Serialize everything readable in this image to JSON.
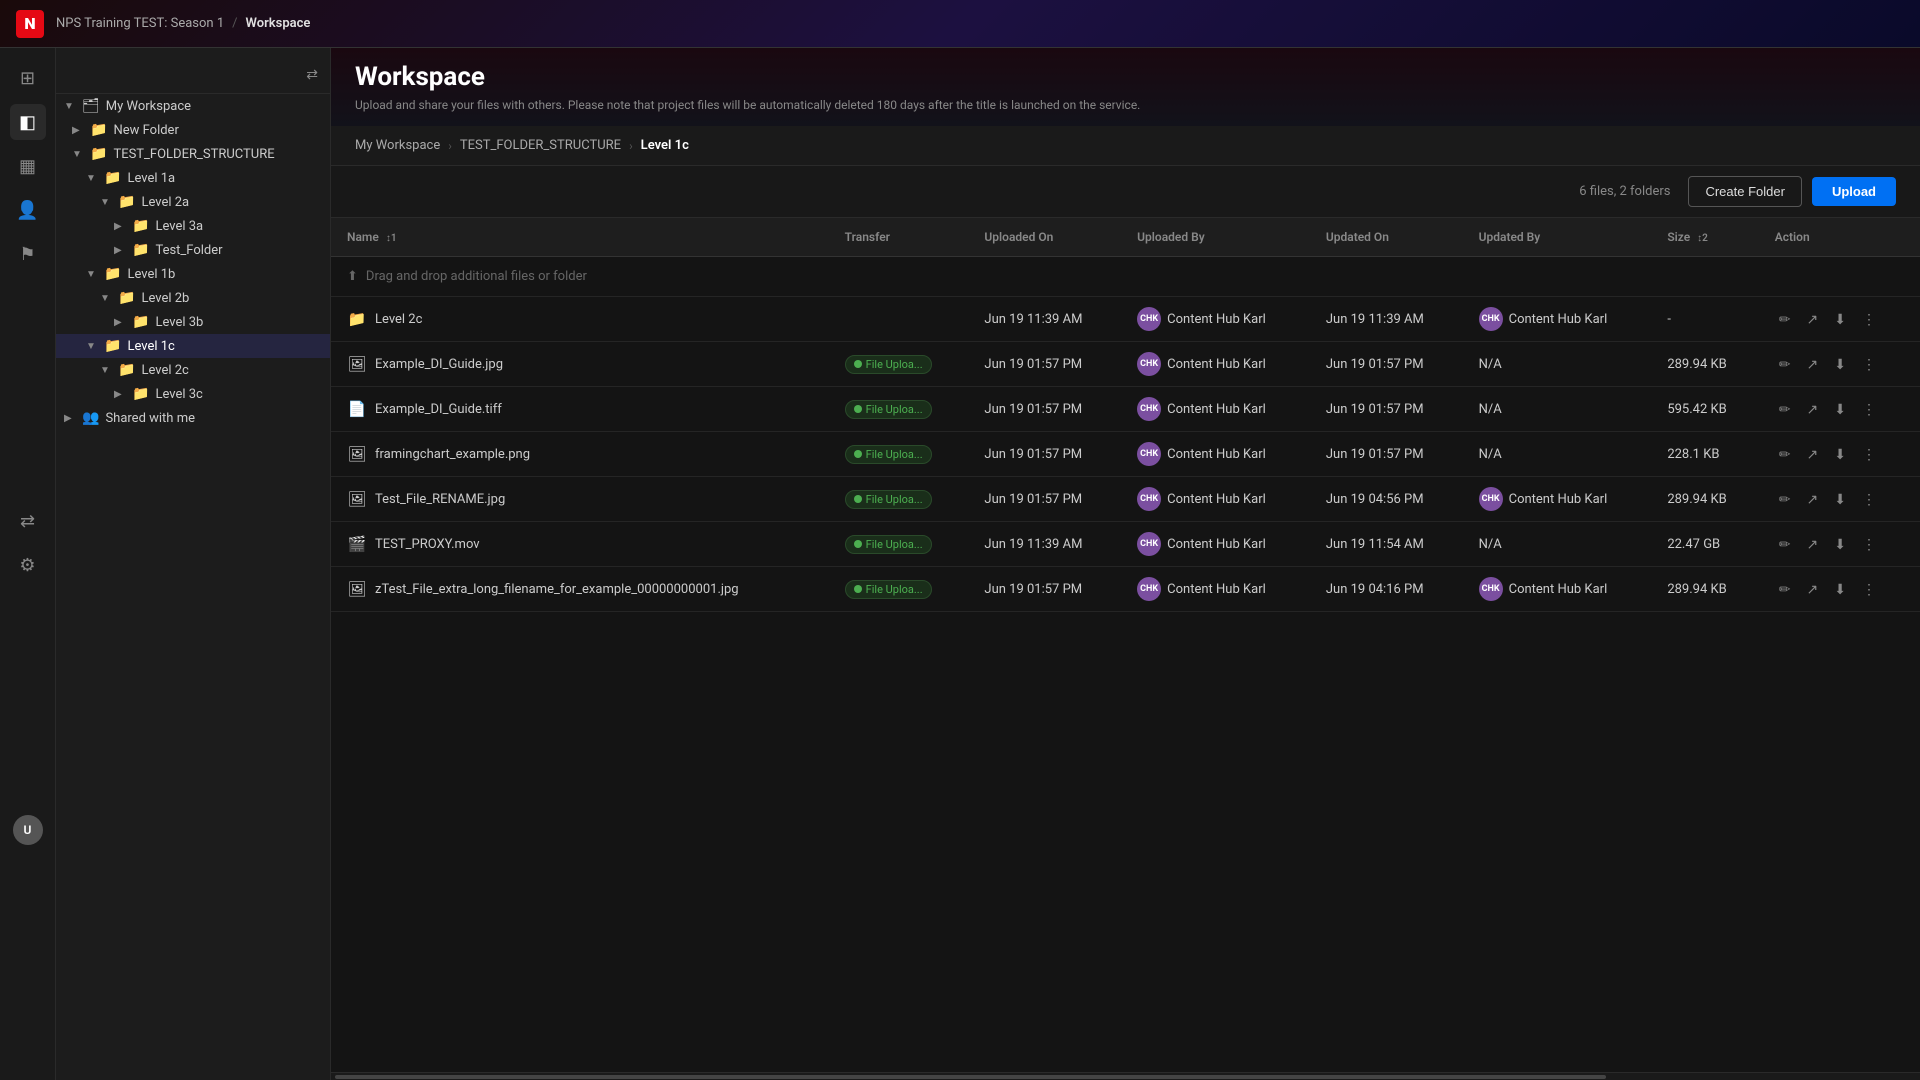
{
  "topbar": {
    "logo": "N",
    "breadcrumb": [
      {
        "label": "NPS Training TEST: Season 1",
        "id": "bc-season"
      },
      {
        "label": "Workspace",
        "id": "bc-workspace",
        "current": true
      }
    ]
  },
  "page": {
    "title": "Workspace",
    "subtitle": "Upload and share your files with others. Please note that project files will be automatically deleted 180 days after the title is launched on the service."
  },
  "breadcrumb_nav": [
    {
      "label": "My Workspace",
      "id": "bc-my-workspace"
    },
    {
      "label": "TEST_FOLDER_STRUCTURE",
      "id": "bc-test-folder"
    },
    {
      "label": "Level 1c",
      "id": "bc-level1c",
      "current": true
    }
  ],
  "toolbar": {
    "file_count": "6 files, 2 folders",
    "create_folder_label": "Create Folder",
    "upload_label": "Upload"
  },
  "table": {
    "headers": [
      {
        "label": "Name",
        "sort": "↕1",
        "id": "col-name"
      },
      {
        "label": "Transfer",
        "id": "col-transfer"
      },
      {
        "label": "Uploaded On",
        "id": "col-uploaded-on"
      },
      {
        "label": "Uploaded By",
        "id": "col-uploaded-by"
      },
      {
        "label": "Updated On",
        "id": "col-updated-on"
      },
      {
        "label": "Updated By",
        "id": "col-updated-by"
      },
      {
        "label": "Size",
        "sort": "↕2",
        "id": "col-size"
      },
      {
        "label": "Action",
        "id": "col-action"
      }
    ],
    "drag_drop_label": "Drag and drop additional files or folder",
    "rows": [
      {
        "id": "row-level2c",
        "name": "Level 2c",
        "type": "folder",
        "transfer": "",
        "uploaded_on": "",
        "uploaded_by": "Content Hub Karl",
        "updated_on": "Jun 19 11:39 AM",
        "updated_by": "Content Hub Karl",
        "size": "-",
        "is_folder": true
      },
      {
        "id": "row-example-di-jpg",
        "name": "Example_DI_Guide.jpg",
        "type": "image",
        "transfer": "File Uploa...",
        "uploaded_on": "Jun 19 01:57 PM",
        "uploaded_by": "Content Hub Karl",
        "updated_on": "Jun 19 01:57 PM",
        "updated_by": "N/A",
        "size": "289.94 KB",
        "is_folder": false
      },
      {
        "id": "row-example-di-tiff",
        "name": "Example_DI_Guide.tiff",
        "type": "file",
        "transfer": "File Uploa...",
        "uploaded_on": "Jun 19 01:57 PM",
        "uploaded_by": "Content Hub Karl",
        "updated_on": "Jun 19 01:57 PM",
        "updated_by": "N/A",
        "size": "595.42 KB",
        "is_folder": false
      },
      {
        "id": "row-framingchart",
        "name": "framingchart_example.png",
        "type": "image",
        "transfer": "File Uploa...",
        "uploaded_on": "Jun 19 01:57 PM",
        "uploaded_by": "Content Hub Karl",
        "updated_on": "Jun 19 01:57 PM",
        "updated_by": "N/A",
        "size": "228.1 KB",
        "is_folder": false
      },
      {
        "id": "row-test-file-rename",
        "name": "Test_File_RENAME.jpg",
        "type": "image",
        "transfer": "File Uploa...",
        "uploaded_on": "Jun 19 01:57 PM",
        "uploaded_by": "Content Hub Karl",
        "updated_on": "Jun 19 04:56 PM",
        "updated_by": "Content Hub Karl",
        "size": "289.94 KB",
        "is_folder": false
      },
      {
        "id": "row-test-proxy",
        "name": "TEST_PROXY.mov",
        "type": "video",
        "transfer": "File Uploa...",
        "uploaded_on": "Jun 19 11:39 AM",
        "uploaded_by": "Content Hub Karl",
        "updated_on": "Jun 19 11:54 AM",
        "updated_by": "N/A",
        "size": "22.47 GB",
        "is_folder": false
      },
      {
        "id": "row-ztest-file",
        "name": "zTest_File_extra_long_filename_for_example_00000000001.jpg",
        "type": "image",
        "transfer": "File Uploa...",
        "uploaded_on": "Jun 19 01:57 PM",
        "uploaded_by": "Content Hub Karl",
        "updated_on": "Jun 19 04:16 PM",
        "updated_by": "Content Hub Karl",
        "size": "289.94 KB",
        "is_folder": false
      }
    ]
  },
  "sidebar": {
    "tree": [
      {
        "label": "My Workspace",
        "level": 0,
        "expanded": true,
        "type": "workspace",
        "id": "node-my-workspace"
      },
      {
        "label": "New Folder",
        "level": 1,
        "expanded": false,
        "type": "folder",
        "id": "node-new-folder"
      },
      {
        "label": "TEST_FOLDER_STRUCTURE",
        "level": 1,
        "expanded": true,
        "type": "folder",
        "id": "node-test-folder"
      },
      {
        "label": "Level 1a",
        "level": 2,
        "expanded": true,
        "type": "folder",
        "id": "node-level1a"
      },
      {
        "label": "Level 2a",
        "level": 3,
        "expanded": true,
        "type": "folder",
        "id": "node-level2a"
      },
      {
        "label": "Level 3a",
        "level": 4,
        "expanded": false,
        "type": "folder",
        "id": "node-level3a"
      },
      {
        "label": "Test_Folder",
        "level": 4,
        "expanded": false,
        "type": "folder",
        "id": "node-test-folder-inner"
      },
      {
        "label": "Level 1b",
        "level": 2,
        "expanded": true,
        "type": "folder",
        "id": "node-level1b"
      },
      {
        "label": "Level 2b",
        "level": 3,
        "expanded": true,
        "type": "folder",
        "id": "node-level2b"
      },
      {
        "label": "Level 3b",
        "level": 4,
        "expanded": false,
        "type": "folder",
        "id": "node-level3b"
      },
      {
        "label": "Level 1c",
        "level": 2,
        "expanded": true,
        "type": "folder",
        "id": "node-level1c",
        "selected": true
      },
      {
        "label": "Level 2c",
        "level": 3,
        "expanded": false,
        "type": "folder",
        "id": "node-level2c"
      },
      {
        "label": "Level 3c",
        "level": 4,
        "expanded": false,
        "type": "folder",
        "id": "node-level3c"
      },
      {
        "label": "Shared with me",
        "level": 0,
        "expanded": false,
        "type": "shared",
        "id": "node-shared"
      }
    ]
  },
  "icons": {
    "folder": "📁",
    "image": "🖼",
    "file": "📄",
    "video": "🎬",
    "workspace": "🗂",
    "shared": "👥"
  },
  "colors": {
    "accent_blue": "#0070f3",
    "accent_green": "#4caf50",
    "avatar_bg": "#7b4fa0",
    "transfer_green": "#4caf50"
  }
}
